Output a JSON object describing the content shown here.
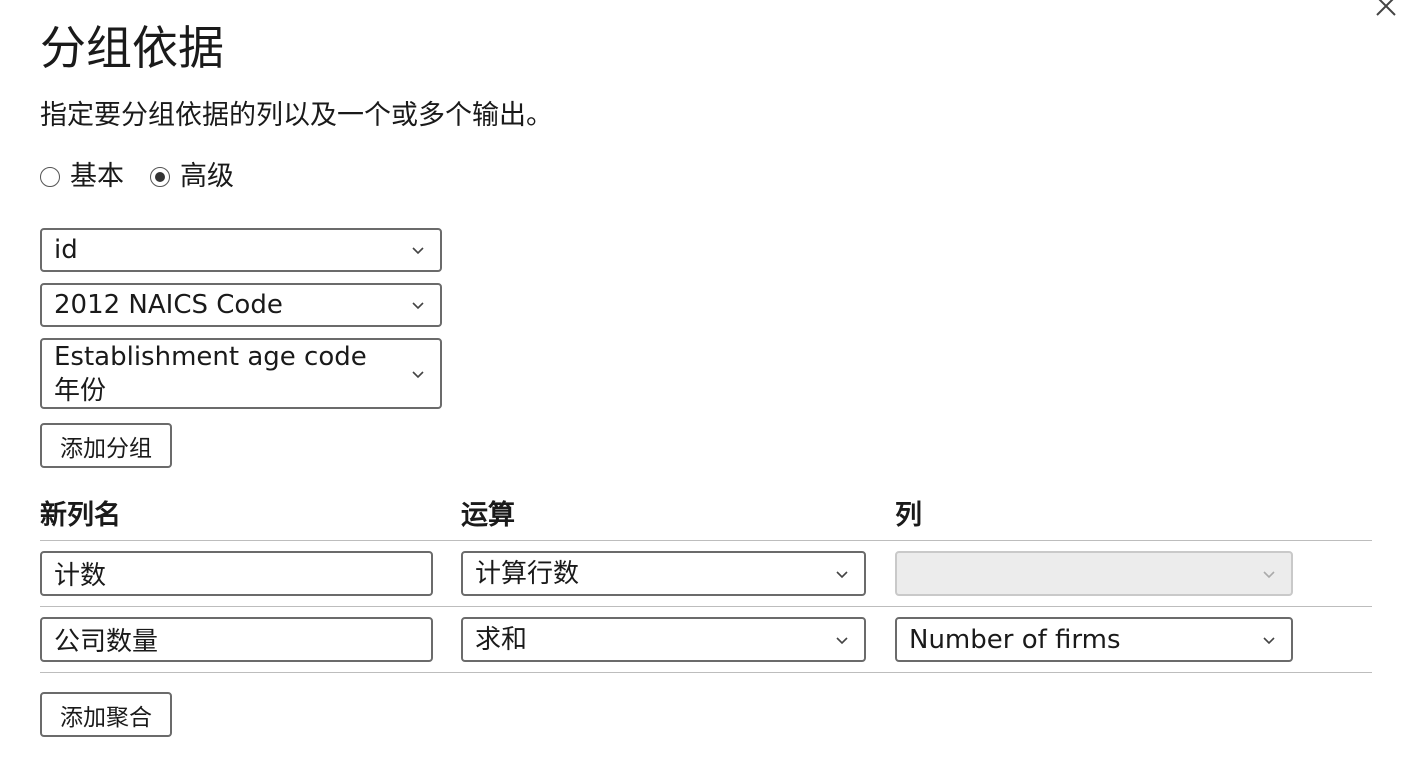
{
  "dialog": {
    "title": "分组依据",
    "subtitle": "指定要分组依据的列以及一个或多个输出。"
  },
  "mode": {
    "options": [
      {
        "label": "基本",
        "selected": false
      },
      {
        "label": "高级",
        "selected": true
      }
    ]
  },
  "group_by": {
    "selects": [
      {
        "value": "id"
      },
      {
        "value": "2012 NAICS Code"
      },
      {
        "value": "Establishment age code\n年份"
      }
    ],
    "add_button_label": "添加分组"
  },
  "aggregations": {
    "headers": {
      "new_column_name": "新列名",
      "operation": "运算",
      "column": "列"
    },
    "rows": [
      {
        "name": "计数",
        "operation": "计算行数",
        "column": "",
        "column_disabled": true
      },
      {
        "name": "公司数量",
        "operation": "求和",
        "column": "Number of firms",
        "column_disabled": false
      }
    ],
    "add_button_label": "添加聚合"
  },
  "icons": {
    "close": "close-icon",
    "chevron": "chevron-down-icon"
  },
  "colors": {
    "border": "#6b6b6b",
    "divider": "#bdbdbd",
    "disabled_bg": "#ececec",
    "text": "#1a1a1a"
  }
}
